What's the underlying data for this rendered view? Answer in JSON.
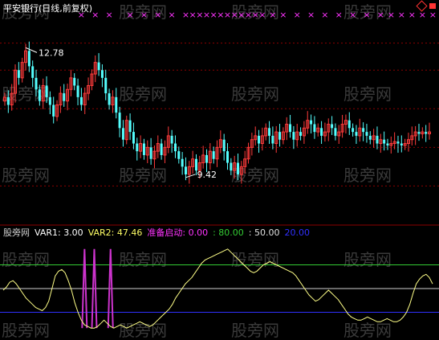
{
  "chart_data": [
    {
      "type": "candlestick",
      "title": "平安银行(日线,前复权)",
      "colors": {
        "up": "#ff3b3b",
        "down": "#54ffff",
        "grid": "#8b0000"
      },
      "price_range": [
        8.5,
        13.6
      ],
      "high_marker": {
        "label": "12.78",
        "value": 12.78
      },
      "low_marker": {
        "label": "9.42",
        "value": 9.42
      },
      "signal_marker": "×",
      "signal_color": "#ff33ff",
      "signal_days": [
        22,
        26,
        30,
        36,
        40,
        44,
        48,
        52,
        54,
        56,
        58,
        60,
        62,
        64,
        66,
        68,
        70,
        72,
        74,
        77,
        80,
        84,
        88,
        92,
        96,
        100,
        104,
        108,
        111,
        114,
        117,
        120,
        123,
        152,
        156,
        160,
        164,
        166,
        168,
        170,
        172,
        174,
        176,
        178
      ],
      "closes": [
        11.5,
        11.3,
        11.6,
        12.2,
        12.0,
        12.4,
        12.7,
        12.3,
        12.0,
        11.7,
        11.4,
        11.8,
        11.5,
        11.3,
        11.0,
        11.3,
        11.6,
        11.4,
        11.7,
        12.0,
        11.8,
        11.5,
        11.3,
        11.6,
        11.8,
        12.1,
        12.4,
        12.2,
        12.0,
        11.6,
        11.3,
        11.5,
        11.1,
        10.7,
        10.4,
        10.9,
        10.6,
        10.3,
        10.1,
        10.3,
        10.0,
        10.2,
        9.9,
        10.1,
        10.3,
        10.0,
        10.2,
        10.5,
        10.3,
        10.1,
        9.9,
        9.7,
        9.5,
        9.7,
        9.9,
        9.6,
        9.8,
        10.0,
        9.8,
        10.1,
        9.9,
        10.2,
        10.4,
        10.1,
        9.8,
        9.6,
        9.8,
        9.5,
        9.7,
        9.9,
        10.2,
        10.4,
        10.5,
        10.3,
        10.5,
        10.7,
        10.5,
        10.3,
        10.6,
        10.4,
        10.6,
        10.8,
        10.6,
        10.4,
        10.6,
        10.5,
        10.7,
        10.9,
        10.8,
        10.6,
        10.7,
        10.5,
        10.6,
        10.8,
        10.7,
        10.5,
        10.6,
        10.8,
        10.9,
        10.7,
        10.6,
        10.5,
        10.7,
        10.6,
        10.5,
        10.4,
        10.5,
        10.3,
        10.4,
        10.3,
        10.25,
        10.3,
        10.35,
        10.3,
        10.25,
        10.3,
        10.4,
        10.5,
        10.6,
        10.55,
        10.6,
        10.55,
        10.6
      ]
    },
    {
      "type": "line",
      "title": "股旁网",
      "ylim": [
        -10,
        110
      ],
      "legend": [
        {
          "text": "股旁网",
          "color": "#cfcfcf"
        },
        {
          "text": "VAR1: 3.00",
          "color": "#ffffff"
        },
        {
          "text": "VAR2: 47.46",
          "color": "#ffff66"
        },
        {
          "text": "准备启动: 0.00",
          "color": "#ff33ff"
        },
        {
          "text": ": 80.00",
          "color": "#33cc33"
        },
        {
          "text": ": 50.00",
          "color": "#e0e0e0"
        },
        {
          "text": "20.00",
          "color": "#3030ff"
        }
      ],
      "reference_lines": [
        {
          "value": 80,
          "color": "#33cc33"
        },
        {
          "value": 50,
          "color": "#cfcfcf"
        },
        {
          "value": 20,
          "color": "#3030ff"
        }
      ],
      "series": [
        {
          "name": "VAR2",
          "color": "#ffff88",
          "values": [
            48,
            52,
            58,
            60,
            56,
            50,
            44,
            38,
            34,
            30,
            26,
            24,
            22,
            26,
            34,
            50,
            66,
            72,
            74,
            70,
            60,
            48,
            32,
            20,
            10,
            4,
            2,
            0,
            0,
            2,
            6,
            10,
            6,
            2,
            0,
            2,
            4,
            2,
            0,
            2,
            4,
            6,
            8,
            6,
            4,
            2,
            4,
            8,
            12,
            16,
            20,
            24,
            30,
            38,
            44,
            50,
            56,
            60,
            64,
            70,
            76,
            82,
            86,
            88,
            90,
            92,
            94,
            96,
            98,
            100,
            96,
            92,
            88,
            84,
            80,
            76,
            72,
            70,
            72,
            76,
            80,
            82,
            84,
            82,
            80,
            78,
            76,
            74,
            72,
            70,
            66,
            60,
            54,
            48,
            42,
            38,
            34,
            36,
            40,
            44,
            48,
            44,
            40,
            36,
            30,
            24,
            18,
            14,
            12,
            10,
            10,
            12,
            14,
            12,
            10,
            8,
            8,
            10,
            12,
            10,
            8,
            8,
            10,
            14,
            20,
            30,
            44,
            56,
            62,
            66,
            68,
            64,
            56
          ]
        }
      ],
      "spikes": {
        "name": "准备启动",
        "color": "#cc33cc",
        "days": [
          25,
          28,
          33
        ],
        "value": 100
      }
    }
  ],
  "watermark": "股旁网"
}
